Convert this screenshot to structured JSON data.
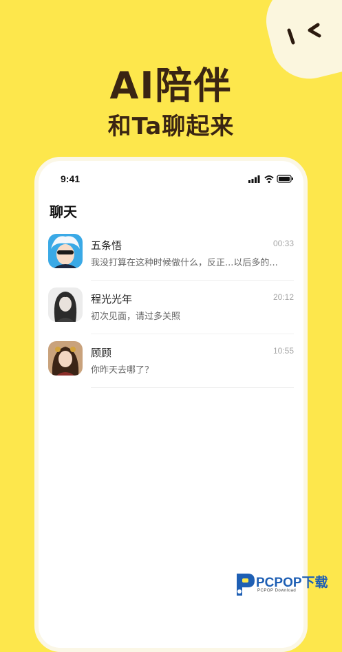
{
  "headline": {
    "title": "AI陪伴",
    "subtitle": "和Ta聊起来"
  },
  "phone": {
    "status_time": "9:41",
    "screen_title": "聊天",
    "chats": [
      {
        "name": "五条悟",
        "time": "00:33",
        "message": "我没打算在这种时候做什么，反正...以后多的..."
      },
      {
        "name": "程光光年",
        "time": "20:12",
        "message": "初次见面，请过多关照"
      },
      {
        "name": "顾顾",
        "time": "10:55",
        "message": "你昨天去哪了？"
      }
    ]
  },
  "watermark": {
    "name": "PCPOP下载",
    "sub": "PCPOP Download"
  },
  "colors": {
    "background": "#fde74c",
    "headline": "#3a2513",
    "mascot": "#fbf6de",
    "watermark": "#1e5fb4"
  }
}
